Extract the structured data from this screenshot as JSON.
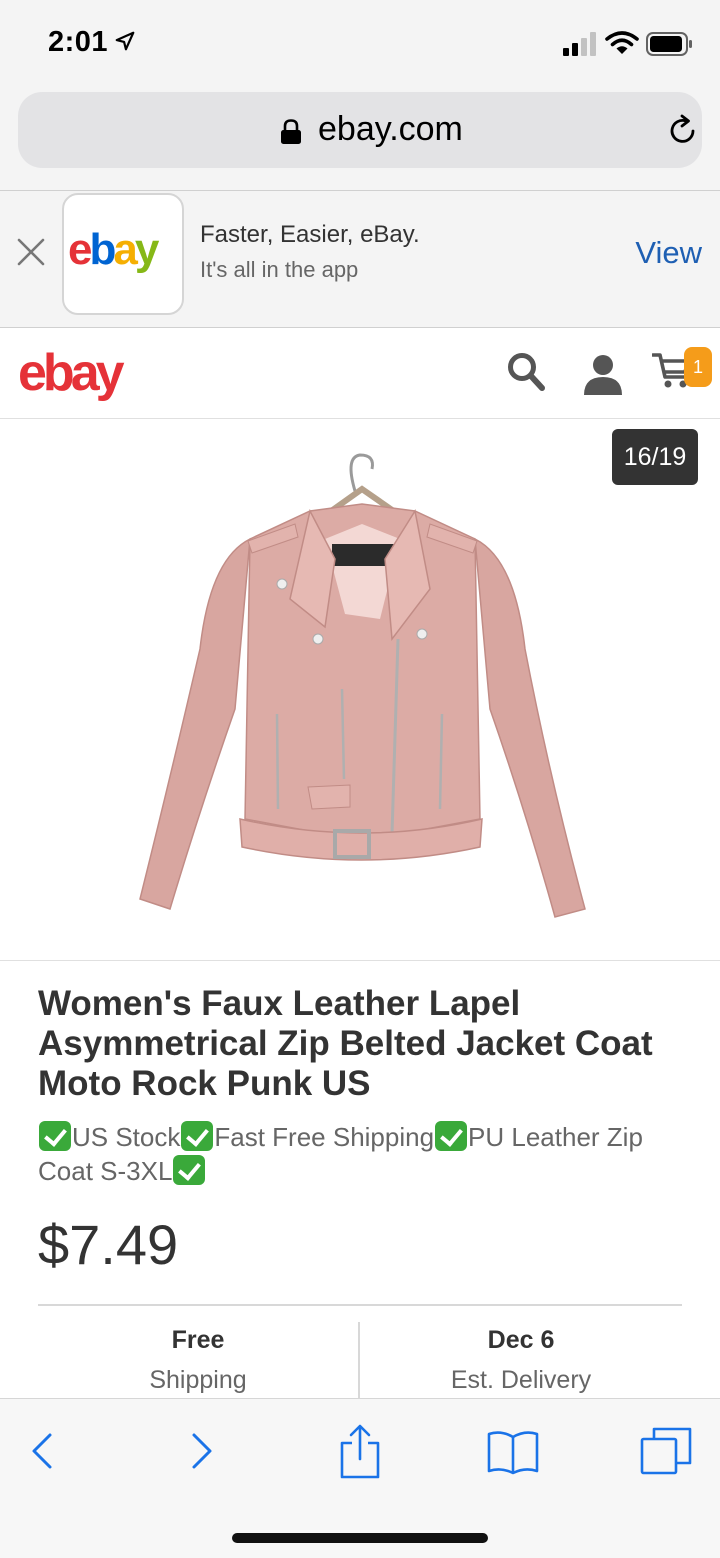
{
  "status_bar": {
    "time": "2:01"
  },
  "browser": {
    "url": "ebay.com"
  },
  "app_banner": {
    "logo": {
      "e": "e",
      "b": "b",
      "a": "a",
      "y": "y"
    },
    "title": "Faster, Easier, eBay.",
    "subtitle": "It's all in the app",
    "view_label": "View"
  },
  "header": {
    "logo": {
      "e": "e",
      "b": "b",
      "a": "a",
      "y": "y"
    },
    "cart_count": "1"
  },
  "gallery": {
    "counter": "16/19"
  },
  "product": {
    "title": "Women's Faux Leather Lapel Asymmetrical Zip Belted Jacket Coat Moto Rock Punk US",
    "subtitle_parts": [
      "US Stock",
      "Fast Free Shipping",
      "PU Leather Zip Coat S-3XL"
    ],
    "price": "$7.49"
  },
  "shipping": {
    "value": "Free",
    "label": "Shipping"
  },
  "delivery": {
    "value": "Dec 6",
    "label": "Est. Delivery"
  },
  "colors": {
    "ebay_red": "#e53238",
    "ebay_blue": "#0064d2",
    "ebay_yellow": "#f5af02",
    "ebay_green": "#86b817",
    "link_blue": "#1e5fb3",
    "badge_orange": "#f59c1a",
    "check_green": "#3aa93a"
  },
  "icons": [
    "location-arrow-icon",
    "signal-icon",
    "wifi-icon",
    "battery-icon",
    "lock-icon",
    "reload-icon",
    "close-icon",
    "search-icon",
    "user-icon",
    "cart-icon",
    "back-icon",
    "forward-icon",
    "share-icon",
    "bookmarks-icon",
    "tabs-icon"
  ]
}
